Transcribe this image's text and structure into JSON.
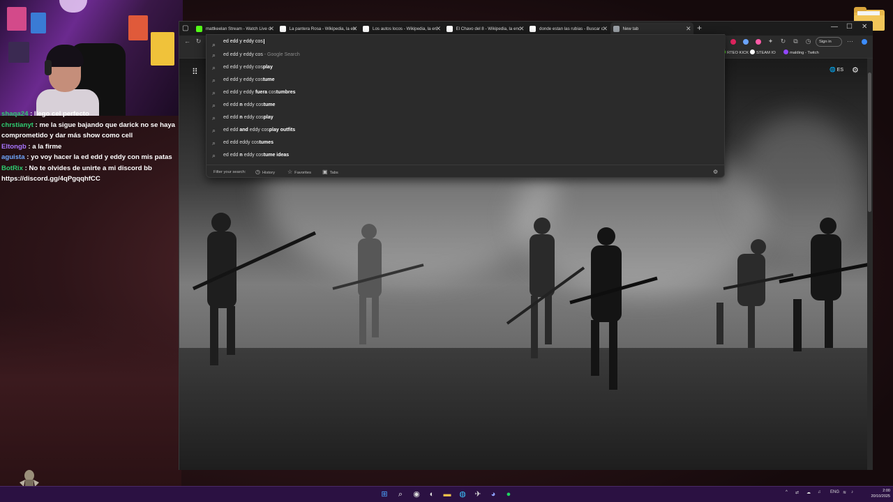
{
  "desktop": {
    "folder_icon": "folder-icon",
    "mascot_icon": "knight-mascot-icon"
  },
  "chat": {
    "partial_top": "shaqa24 : llego cel perfecto",
    "lines": [
      {
        "user": "shaqa24",
        "color": "#2ecc71",
        "message": " : llego cel perfecto"
      },
      {
        "user": "chrstianyt",
        "color": "#2ecc71",
        "message": " : me la sigue bajando que darick no se haya comprometido y dar más show como cell"
      },
      {
        "user": "Eltongb",
        "color": "#a875ff",
        "message": " : a la firme"
      },
      {
        "user": "aguista",
        "color": "#6fa8ff",
        "message": " : yo voy hacer la ed edd y eddy con mis patas"
      },
      {
        "user": "BotRix",
        "color": "#2ecc71",
        "message": " : No te olvides de unirte a mi discord bb https://discord.gg/4qPgqqhfCC"
      }
    ]
  },
  "browser": {
    "tabs": [
      {
        "title": "mattkeelan Stream - Watch Live o",
        "icon_color": "#53fc18"
      },
      {
        "title": "La pantera Rosa - Wikipedia, la en",
        "icon_color": "#ffffff"
      },
      {
        "title": "Los autos locos - Wikipedia, la en",
        "icon_color": "#ffffff"
      },
      {
        "title": "El Chavo del 8 - Wikipedia, la enc",
        "icon_color": "#ffffff"
      },
      {
        "title": "donde estan las rubias - Buscar c",
        "icon_color": "#ffffff"
      },
      {
        "title": "New tab",
        "icon_color": "#9aa0a6"
      }
    ],
    "new_tab_symbol": "+",
    "window_controls": {
      "minimize": "—",
      "maximize": "☐",
      "close": "✕"
    },
    "signin_label": "Sign in",
    "favorites": [
      {
        "label": "RTEO KICK",
        "color": "#53fc18"
      },
      {
        "label": "STEAM IO",
        "color": "#ffffff"
      },
      {
        "label": "malding - Twitch",
        "color": "#9146ff"
      }
    ],
    "newtab": {
      "language": "ES",
      "apps_icon": "apps-grid-icon",
      "settings_icon": "gear-icon"
    },
    "omnibox": {
      "query": "ed edd y eddy cos",
      "suggestions": [
        {
          "plain": "ed edd y eddy cos",
          "bold": "",
          "hint": " - Google Search"
        },
        {
          "plain": "ed edd y eddy cos",
          "bold": "play",
          "hint": ""
        },
        {
          "plain": "ed edd y eddy cos",
          "bold": "tume",
          "hint": ""
        },
        {
          "plain": "ed edd y eddy ",
          "bold": "fuera",
          "mid": " cos",
          "bold2": "tumbres",
          "hint": ""
        },
        {
          "plain": "ed edd ",
          "bold": "n",
          "mid": " eddy cos",
          "bold2": "tume",
          "hint": ""
        },
        {
          "plain": "ed edd ",
          "bold": "n",
          "mid": " eddy cos",
          "bold2": "play",
          "hint": ""
        },
        {
          "plain": "ed edd ",
          "bold": "and",
          "mid": " eddy cos",
          "bold2": "play outfits",
          "hint": ""
        },
        {
          "plain": "ed edd eddy cos",
          "bold": "tumes",
          "hint": ""
        },
        {
          "plain": "ed edd ",
          "bold": "n",
          "mid": " eddy cos",
          "bold2": "tume ideas",
          "hint": ""
        }
      ],
      "footer": {
        "filter_placeholder": "Filter your search:",
        "history": "History",
        "favorites": "Favorites",
        "tabs": "Tabs"
      }
    }
  },
  "taskbar": {
    "tray": {
      "lang": "ENG"
    },
    "clock": {
      "time": "2:00",
      "date": "20/10/2025"
    }
  }
}
